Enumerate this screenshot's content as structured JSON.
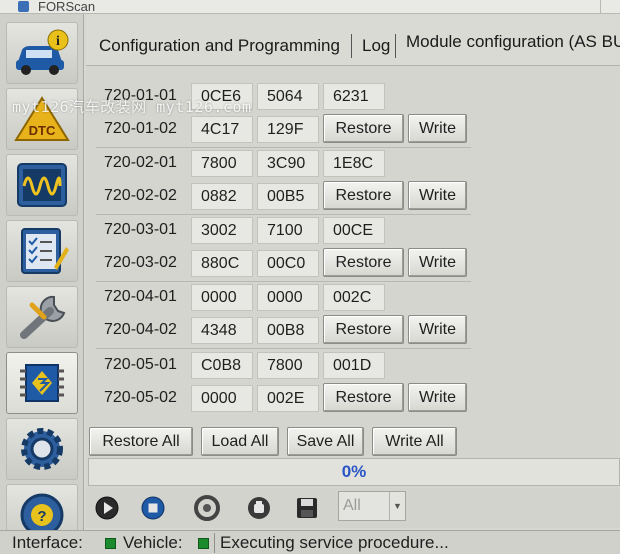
{
  "window": {
    "title": "FORScan"
  },
  "tabs": [
    {
      "label": "Configuration and Programming"
    },
    {
      "label": "Log"
    },
    {
      "label": "Module configuration (AS BU"
    }
  ],
  "sidebar": {
    "items": [
      {
        "icon": "car-info-icon"
      },
      {
        "icon": "dtc-icon"
      },
      {
        "icon": "oscilloscope-icon"
      },
      {
        "icon": "checklist-icon"
      },
      {
        "icon": "wrench-icon"
      },
      {
        "icon": "chip-icon"
      },
      {
        "icon": "gear-icon"
      },
      {
        "icon": "help-icon"
      }
    ]
  },
  "config": {
    "rows": [
      {
        "label": "720-01-01",
        "cells": [
          "0CE6",
          "5064",
          "6231"
        ]
      },
      {
        "label": "720-01-02",
        "cells": [
          "4C17",
          "129F"
        ]
      },
      {
        "label": "720-02-01",
        "cells": [
          "7800",
          "3C90",
          "1E8C"
        ]
      },
      {
        "label": "720-02-02",
        "cells": [
          "0882",
          "00B5"
        ]
      },
      {
        "label": "720-03-01",
        "cells": [
          "3002",
          "7100",
          "00CE"
        ]
      },
      {
        "label": "720-03-02",
        "cells": [
          "880C",
          "00C0"
        ]
      },
      {
        "label": "720-04-01",
        "cells": [
          "0000",
          "0000",
          "002C"
        ]
      },
      {
        "label": "720-04-02",
        "cells": [
          "4348",
          "00B8"
        ]
      },
      {
        "label": "720-05-01",
        "cells": [
          "C0B8",
          "7800",
          "001D"
        ]
      },
      {
        "label": "720-05-02",
        "cells": [
          "0000",
          "002E"
        ]
      }
    ],
    "restore_label": "Restore",
    "write_label": "Write"
  },
  "actions": {
    "restore_all": "Restore All",
    "load_all": "Load All",
    "save_all": "Save All",
    "write_all": "Write All"
  },
  "progress": {
    "text": "0%",
    "value": 0
  },
  "toolbar": {
    "tools": [
      "play-icon",
      "stop-icon",
      "tire-icon",
      "reset-icon",
      "save-icon"
    ],
    "select_value": "All"
  },
  "status": {
    "interface_label": "Interface:",
    "vehicle_label": "Vehicle:",
    "message": "Executing service procedure..."
  },
  "watermark": {
    "text": "myt126汽车改装网  myt126.com"
  },
  "colors": {
    "progress_text": "#2a55c7",
    "led": "#1b8a2c"
  }
}
